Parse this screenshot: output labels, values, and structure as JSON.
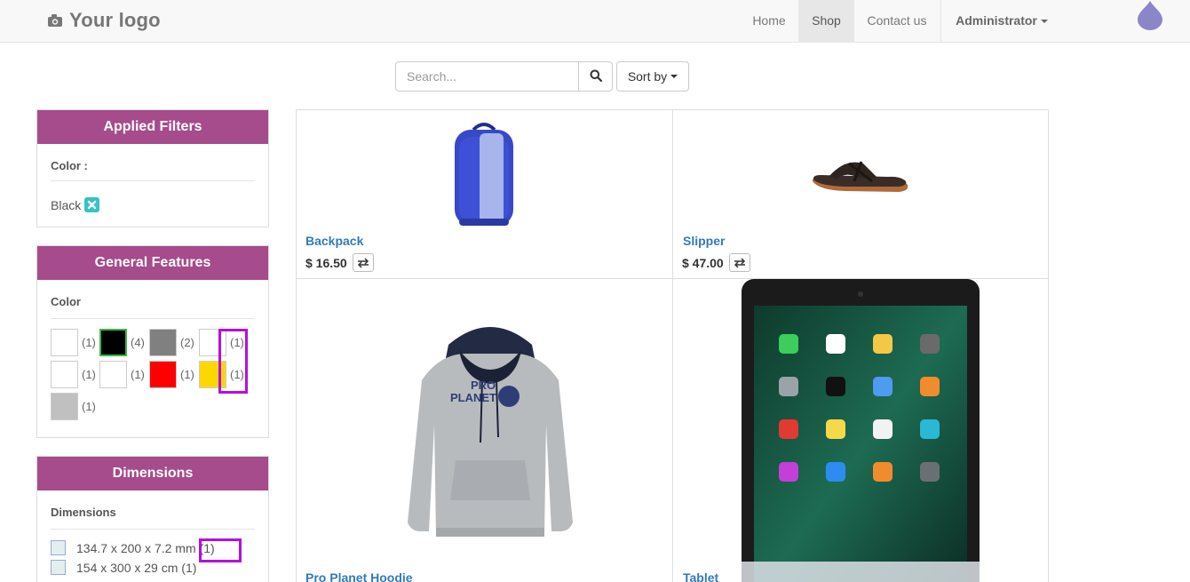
{
  "brand": {
    "logo_text": "Your logo"
  },
  "nav": {
    "home": "Home",
    "shop": "Shop",
    "contact": "Contact us",
    "admin": "Administrator"
  },
  "search": {
    "placeholder": "Search...",
    "sort_label": "Sort by"
  },
  "applied_filters": {
    "title": "Applied Filters",
    "group_label": "Color :",
    "chips": [
      {
        "label": "Black"
      }
    ]
  },
  "general_features": {
    "title": "General Features",
    "attribute_label": "Color",
    "swatches": [
      {
        "color": "#ffffff",
        "count": "(1)"
      },
      {
        "color": "#000000",
        "count": "(4)",
        "selected": true
      },
      {
        "color": "#808080",
        "count": "(2)"
      },
      {
        "color": "#ffffff",
        "count": "(1)"
      },
      {
        "color": "#ffffff",
        "count": "(1)"
      },
      {
        "color": "#ffffff",
        "count": "(1)"
      },
      {
        "color": "#ff0000",
        "count": "(1)"
      },
      {
        "color": "#ffd700",
        "count": "(1)"
      },
      {
        "color": "#c0c0c0",
        "count": "(1)"
      }
    ]
  },
  "dimensions": {
    "title": "Dimensions",
    "attribute_label": "Dimensions",
    "options": [
      {
        "label": "134.7 x 200 x 7.2 mm",
        "count": "(1)"
      },
      {
        "label": "154 x 300 x 29 cm",
        "count": "(1)"
      }
    ]
  },
  "products": [
    {
      "name": "Backpack",
      "price": "$ 16.50",
      "image": "backpack"
    },
    {
      "name": "Slipper",
      "price": "$ 47.00",
      "image": "slipper"
    },
    {
      "name": "Pro Planet Hoodie",
      "price": "",
      "image": "hoodie"
    },
    {
      "name": "Tablet",
      "price": "",
      "image": "tablet"
    }
  ],
  "colors": {
    "accent": "#a64b8b",
    "link": "#337ab7",
    "chip": "#33c3c7",
    "highlight": "#b40fe0"
  }
}
